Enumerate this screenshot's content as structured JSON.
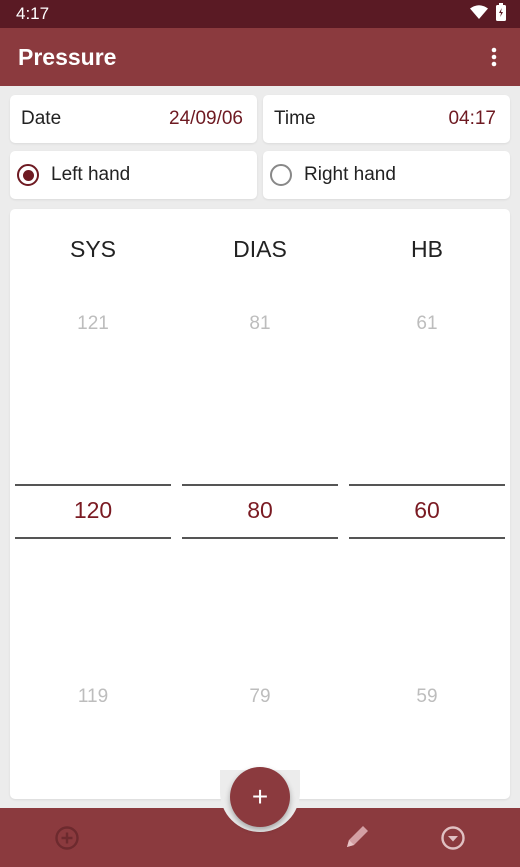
{
  "status_bar": {
    "time": "4:17"
  },
  "app_bar": {
    "title": "Pressure"
  },
  "date_field": {
    "label": "Date",
    "value": "24/09/06"
  },
  "time_field": {
    "label": "Time",
    "value": "04:17"
  },
  "hand": {
    "left_label": "Left hand",
    "right_label": "Right hand",
    "selected": "left"
  },
  "picker": {
    "columns": [
      {
        "header": "SYS",
        "prev": "121",
        "current": "120",
        "next": "119"
      },
      {
        "header": "DIAS",
        "prev": "81",
        "current": "80",
        "next": "79"
      },
      {
        "header": "HB",
        "prev": "61",
        "current": "60",
        "next": "59"
      }
    ]
  },
  "fab": {
    "label": "+"
  },
  "bottom_nav": {
    "icons": [
      "add-circle-icon",
      "pencil-icon",
      "chevron-down-circle-icon"
    ]
  },
  "colors": {
    "primary": "#8b3a3e",
    "status_bar": "#5a1a24",
    "accent_text": "#6e1a22",
    "background": "#ececec"
  }
}
